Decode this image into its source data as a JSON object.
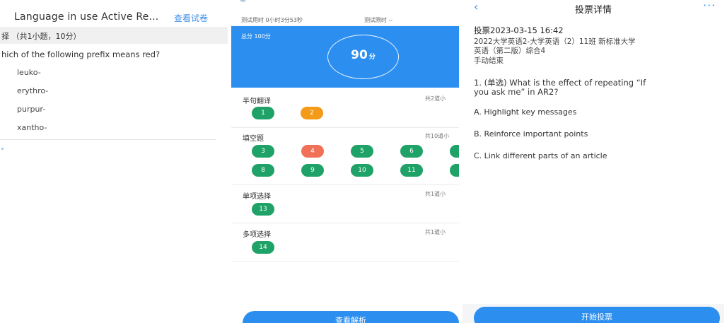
{
  "panel1": {
    "header_title": "Language in use Active Re...",
    "view_paper_link": "查看试卷",
    "section_label": "择 （共1小题，10分）",
    "question": "hich of the following prefix means red?",
    "options": [
      "leuko-",
      "erythro-",
      "purpur-",
      "xantho-"
    ]
  },
  "panel2": {
    "time_used": "测试用时 0小时3分53秒",
    "time_limit": "测试限时 --",
    "total_score": "总分 100分",
    "score_value": "90",
    "score_unit": "分",
    "sections": [
      {
        "title": "半句翻译",
        "count": "共2道小",
        "questions": [
          {
            "n": "1",
            "status": "correct"
          },
          {
            "n": "2",
            "status": "partial"
          }
        ]
      },
      {
        "title": "填空题",
        "count": "共10道小",
        "questions": [
          {
            "n": "3",
            "status": "correct"
          },
          {
            "n": "4",
            "status": "wrong"
          },
          {
            "n": "5",
            "status": "correct"
          },
          {
            "n": "6",
            "status": "correct"
          },
          {
            "n": "",
            "status": "correct"
          },
          {
            "n": "8",
            "status": "correct"
          },
          {
            "n": "9",
            "status": "correct"
          },
          {
            "n": "10",
            "status": "correct"
          },
          {
            "n": "11",
            "status": "correct"
          },
          {
            "n": "",
            "status": "correct"
          }
        ]
      },
      {
        "title": "单项选择",
        "count": "共1道小",
        "questions": [
          {
            "n": "13",
            "status": "correct"
          }
        ]
      },
      {
        "title": "多项选择",
        "count": "共1道小",
        "questions": [
          {
            "n": "14",
            "status": "correct"
          }
        ]
      }
    ],
    "bottom_button": "查看解析",
    "colors": {
      "primary": "#2c8ff0",
      "correct": "#1fa267",
      "partial": "#f39a18",
      "wrong": "#f07058"
    }
  },
  "panel3": {
    "title": "投票详情",
    "back_icon": "chevron-left-icon",
    "more_icon": "more-horizontal-icon",
    "datetime": "投票2023-03-15 16:42",
    "class_line1": "2022大学英语2-大学英语（2）11班  新标准大学",
    "class_line2": "英语（第二版）综合4",
    "status": "手动结束",
    "question_line1": "1. (单选) What is the effect of repeating “If",
    "question_line2": "you ask me” in AR2?",
    "options": [
      "A. Highlight key messages",
      "B. Reinforce important points",
      "C. Link different parts of an article"
    ],
    "start_button": "开始投票"
  }
}
